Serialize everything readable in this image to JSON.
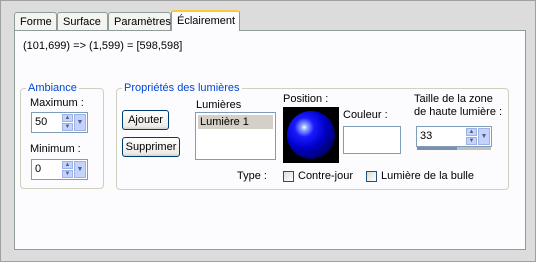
{
  "tabs": [
    {
      "label": "Forme"
    },
    {
      "label": "Surface"
    },
    {
      "label": "Paramètres"
    },
    {
      "label": "Éclairement",
      "active": true
    }
  ],
  "formula": "(101,699) => (1,599) = [598,598]",
  "ambiance": {
    "legend": "Ambiance",
    "max_label": "Maximum :",
    "max_value": "50",
    "min_label": "Minimum :",
    "min_value": "0"
  },
  "lights": {
    "legend": "Propriétés des lumières",
    "add_button": "Ajouter",
    "delete_button": "Supprimer",
    "list_label": "Lumières",
    "items": [
      "Lumière 1"
    ],
    "position_label": "Position :",
    "color_label": "Couleur :",
    "highlight_label_line1": "Taille de la zone",
    "highlight_label_line2": "de haute lumière :",
    "highlight_value": "33",
    "type_label": "Type :",
    "backlight_label": "Contre-jour",
    "bubble_light_label": "Lumière de la bulle",
    "backlight_checked": false,
    "bubble_light_checked": false
  },
  "icons": {
    "spin_up": "arrow-up-icon",
    "spin_down": "arrow-down-icon",
    "dropdown": "chevron-down-icon"
  }
}
